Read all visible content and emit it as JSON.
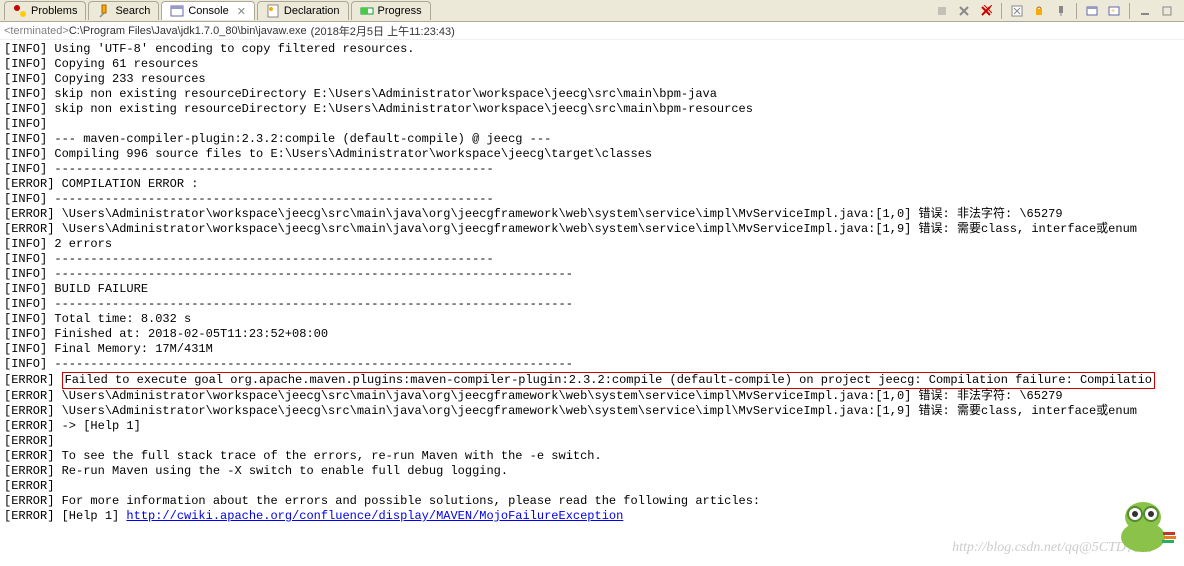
{
  "tabs": {
    "problems": "Problems",
    "search": "Search",
    "console": "Console",
    "declaration": "Declaration",
    "progress": "Progress"
  },
  "term": {
    "status": "<terminated>",
    "path": "C:\\Program Files\\Java\\jdk1.7.0_80\\bin\\javaw.exe",
    "date": "(2018年2月5日 上午11:23:43)"
  },
  "lines": [
    "[INFO] Using 'UTF-8' encoding to copy filtered resources.",
    "[INFO] Copying 61 resources",
    "[INFO] Copying 233 resources",
    "[INFO] skip non existing resourceDirectory E:\\Users\\Administrator\\workspace\\jeecg\\src\\main\\bpm-java",
    "[INFO] skip non existing resourceDirectory E:\\Users\\Administrator\\workspace\\jeecg\\src\\main\\bpm-resources",
    "[INFO] ",
    "[INFO] --- maven-compiler-plugin:2.3.2:compile (default-compile) @ jeecg ---",
    "[INFO] Compiling 996 source files to E:\\Users\\Administrator\\workspace\\jeecg\\target\\classes",
    "[INFO] -------------------------------------------------------------",
    "[ERROR] COMPILATION ERROR : ",
    "[INFO] -------------------------------------------------------------",
    "[ERROR] \\Users\\Administrator\\workspace\\jeecg\\src\\main\\java\\org\\jeecgframework\\web\\system\\service\\impl\\MvServiceImpl.java:[1,0] 错误: 非法字符: \\65279",
    "[ERROR] \\Users\\Administrator\\workspace\\jeecg\\src\\main\\java\\org\\jeecgframework\\web\\system\\service\\impl\\MvServiceImpl.java:[1,9] 错误: 需要class, interface或enum",
    "[INFO] 2 errors ",
    "[INFO] -------------------------------------------------------------",
    "[INFO] ------------------------------------------------------------------------",
    "[INFO] BUILD FAILURE",
    "[INFO] ------------------------------------------------------------------------",
    "[INFO] Total time: 8.032 s",
    "[INFO] Finished at: 2018-02-05T11:23:52+08:00",
    "[INFO] Final Memory: 17M/431M",
    "[INFO] ------------------------------------------------------------------------"
  ],
  "error_box_prefix": "[ERROR] ",
  "error_box": "Failed to execute goal org.apache.maven.plugins:maven-compiler-plugin:2.3.2:compile (default-compile) on project jeecg: Compilation failure: Compilatio",
  "lines2": [
    "[ERROR] \\Users\\Administrator\\workspace\\jeecg\\src\\main\\java\\org\\jeecgframework\\web\\system\\service\\impl\\MvServiceImpl.java:[1,0] 错误: 非法字符: \\65279",
    "[ERROR] \\Users\\Administrator\\workspace\\jeecg\\src\\main\\java\\org\\jeecgframework\\web\\system\\service\\impl\\MvServiceImpl.java:[1,9] 错误: 需要class, interface或enum",
    "[ERROR] -> [Help 1]",
    "[ERROR] ",
    "[ERROR] To see the full stack trace of the errors, re-run Maven with the -e switch.",
    "[ERROR] Re-run Maven using the -X switch to enable full debug logging.",
    "[ERROR] ",
    "[ERROR] For more information about the errors and possible solutions, please read the following articles:"
  ],
  "help_prefix": "[ERROR] [Help 1] ",
  "help_link": "http://cwiki.apache.org/confluence/display/MAVEN/MojoFailureException",
  "watermark": "http://blog.csdn.net/qq@5CTD博客"
}
